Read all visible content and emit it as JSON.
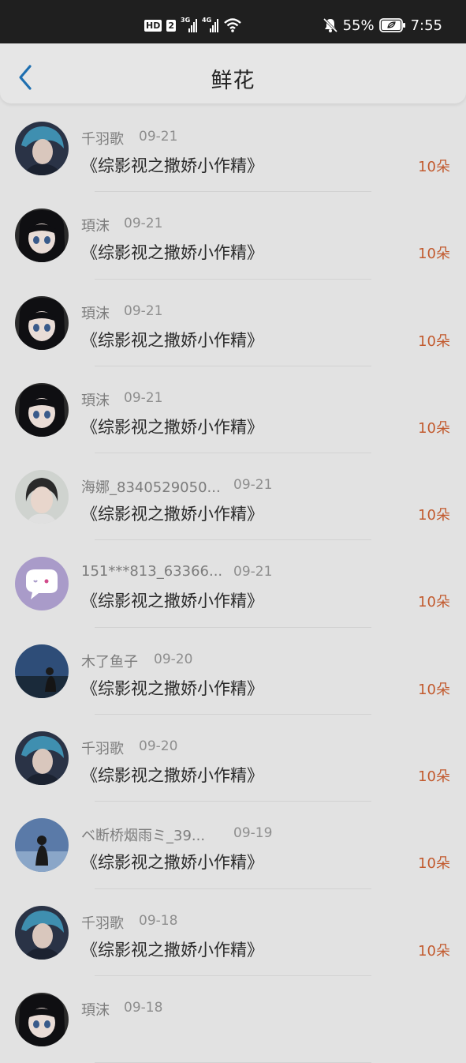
{
  "status_bar": {
    "hd": "HD",
    "sim": "2",
    "net1": "3G",
    "net2": "4G",
    "battery": "55%",
    "time": "7:55"
  },
  "header": {
    "title": "鲜花",
    "back_icon": "chevron-left-icon"
  },
  "colors": {
    "accent": "#1e6fb0",
    "count": "#c25a2e",
    "status_bg": "#1f1f1f",
    "page_bg": "#e2e2e2"
  },
  "items": [
    {
      "user": "千羽歌",
      "date": "09-21",
      "book": "《综影视之撒娇小作精》",
      "count": "10朵",
      "avatar": "boy-blue-hair"
    },
    {
      "user": "頊沫",
      "date": "09-21",
      "book": "《综影视之撒娇小作精》",
      "count": "10朵",
      "avatar": "anime-girl"
    },
    {
      "user": "頊沫",
      "date": "09-21",
      "book": "《综影视之撒娇小作精》",
      "count": "10朵",
      "avatar": "anime-girl"
    },
    {
      "user": "頊沫",
      "date": "09-21",
      "book": "《综影视之撒娇小作精》",
      "count": "10朵",
      "avatar": "anime-girl"
    },
    {
      "user": "海娜_8340529050...",
      "date": "09-21",
      "book": "《综影视之撒娇小作精》",
      "count": "10朵",
      "avatar": "girl-photo"
    },
    {
      "user": "151***813_63366...",
      "date": "09-21",
      "book": "《综影视之撒娇小作精》",
      "count": "10朵",
      "avatar": "default-chat"
    },
    {
      "user": "木了鱼子",
      "date": "09-20",
      "book": "《综影视之撒娇小作精》",
      "count": "10朵",
      "avatar": "night-sky"
    },
    {
      "user": "千羽歌",
      "date": "09-20",
      "book": "《综影视之撒娇小作精》",
      "count": "10朵",
      "avatar": "boy-blue-hair"
    },
    {
      "user": "ベ断桥烟雨ミ_39...",
      "date": "09-19",
      "book": "《综影视之撒娇小作精》",
      "count": "10朵",
      "avatar": "girl-sky"
    },
    {
      "user": "千羽歌",
      "date": "09-18",
      "book": "《综影视之撒娇小作精》",
      "count": "10朵",
      "avatar": "boy-blue-hair"
    },
    {
      "user": "頊沫",
      "date": "09-18",
      "book": "",
      "count": "",
      "avatar": "anime-girl"
    }
  ]
}
